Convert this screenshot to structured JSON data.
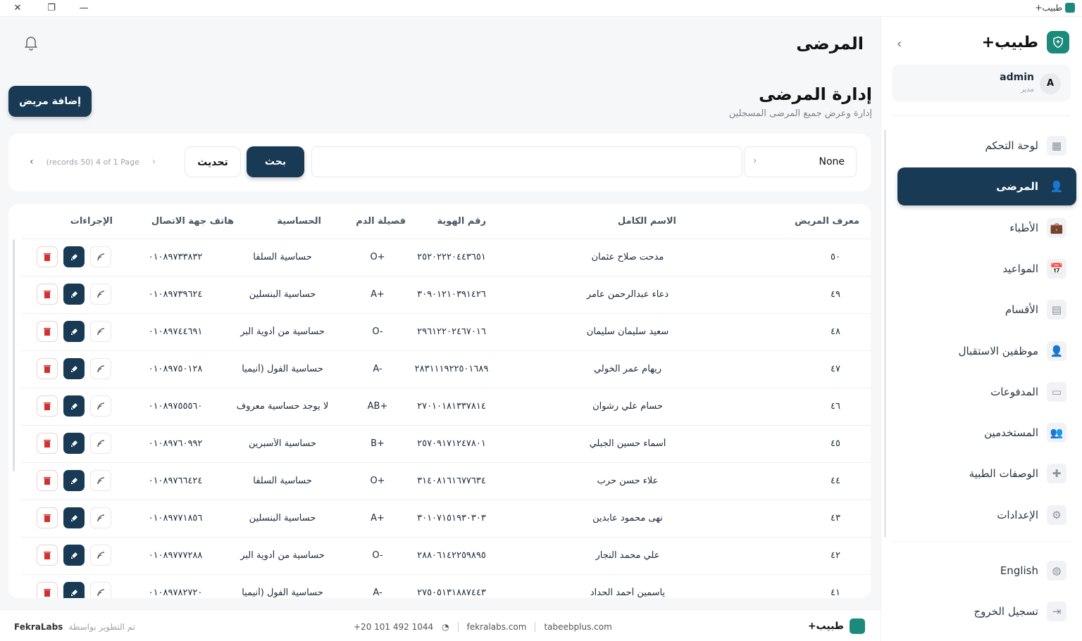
{
  "titlebar": {
    "app_title": "طبيب+",
    "close": "✕",
    "restore": "❐",
    "minimize": "—"
  },
  "sidebar": {
    "brand": "طبيب+",
    "user": {
      "initial": "A",
      "name": "admin",
      "role": "مدير"
    },
    "items": [
      {
        "label": "لوحة التحكم",
        "icon": "dashboard-icon",
        "glyph": "▦"
      },
      {
        "label": "المرضى",
        "icon": "person-icon",
        "glyph": "👤",
        "active": true
      },
      {
        "label": "الأطباء",
        "icon": "briefcase-icon",
        "glyph": "💼"
      },
      {
        "label": "المواعيد",
        "icon": "calendar-icon",
        "glyph": "📅"
      },
      {
        "label": "الأقسام",
        "icon": "building-icon",
        "glyph": "▤"
      },
      {
        "label": "موظفين الاستقبال",
        "icon": "person-icon",
        "glyph": "👤"
      },
      {
        "label": "المدفوعات",
        "icon": "card-icon",
        "glyph": "▭"
      },
      {
        "label": "المستخدمين",
        "icon": "group-icon",
        "glyph": "👥"
      },
      {
        "label": "الوصفات الطبية",
        "icon": "medical-plus-icon",
        "glyph": "✚"
      },
      {
        "label": "الإعدادات",
        "icon": "gear-icon",
        "glyph": "⚙"
      }
    ],
    "language": {
      "label": "English",
      "icon": "globe-icon"
    },
    "logout": {
      "label": "تسجيل الخروج",
      "icon": "logout-icon"
    }
  },
  "header": {
    "title": "المرضى"
  },
  "section": {
    "title": "إدارة المرضى",
    "subtitle": "إدارة وعرض جميع المرضى المسجلين",
    "add_label": "إضافة مريض"
  },
  "filters": {
    "select_value": "None",
    "search_label": "بحث",
    "refresh_label": "تحديث",
    "page_info": "(records 50) 4 of 1 Page"
  },
  "table": {
    "headers": {
      "id": "معرف المريض",
      "name": "الاسم الكامل",
      "national_id": "رقم الهوية",
      "blood": "فصيلة الدم",
      "allergy": "الحساسية",
      "phone": "هاتف جهة الاتصال",
      "actions": "الإجراءات"
    },
    "rows": [
      {
        "id": "٥٠",
        "name": "مدحت صلاح عثمان",
        "national_id": "٢٥٢٠٢٢٢٠٤٤٣٦٥١",
        "blood": "O+",
        "allergy": "حساسية السلفا",
        "phone": "٠١٠٨٩٧٣٣٨٣٢"
      },
      {
        "id": "٤٩",
        "name": "دعاء عبدالرحمن عامر",
        "national_id": "٣٠٩٠١٢١٠٣٩١٤٢٦",
        "blood": "A+",
        "allergy": "حساسية البنسلين",
        "phone": "٠١٠٨٩٧٣٩٦٢٤"
      },
      {
        "id": "٤٨",
        "name": "سعيد سليمان سليمان",
        "national_id": "٢٩٦١٢٢٠٢٤٦٧٠١٦",
        "blood": "O-",
        "allergy": "حساسية من أدوية البر",
        "phone": "٠١٠٨٩٧٤٤٦٩١"
      },
      {
        "id": "٤٧",
        "name": "ريهام عمر الخولي",
        "national_id": "٢٨٣١١١٩٢٢٥٠١٦٨٩",
        "blood": "A-",
        "allergy": "حساسية الفول (أنيميا",
        "phone": "٠١٠٨٩٧٥٠١٢٨"
      },
      {
        "id": "٤٦",
        "name": "حسام علي رشوان",
        "national_id": "٢٧٠١٠١٨١٣٣٧٨١٤",
        "blood": "AB+",
        "allergy": "لا يوجد حساسية معروف",
        "phone": "٠١٠٨٩٧٥٥٥٦٠"
      },
      {
        "id": "٤٥",
        "name": "أسماء حسين الجبلي",
        "national_id": "٢٥٧٠٩١٧١٢٤٧٨٠١",
        "blood": "B+",
        "allergy": "حساسية الأسبرين",
        "phone": "٠١٠٨٩٧٦٠٩٩٢"
      },
      {
        "id": "٤٤",
        "name": "علاء حسن حرب",
        "national_id": "٣١٤٠٨١٦١٦٧٧٦٣٤",
        "blood": "O+",
        "allergy": "حساسية السلفا",
        "phone": "٠١٠٨٩٧٦٦٤٢٤"
      },
      {
        "id": "٤٣",
        "name": "نهى محمود عابدين",
        "national_id": "٣٠١٠٧١٥١٩٣٠٣٠٣",
        "blood": "A+",
        "allergy": "حساسية البنسلين",
        "phone": "٠١٠٨٩٧٧١٨٥٦"
      },
      {
        "id": "٤٢",
        "name": "علي محمد النجار",
        "national_id": "٢٨٨٠٦١٤٢٢٥٩٨٩٥",
        "blood": "O-",
        "allergy": "حساسية من أدوية البر",
        "phone": "٠١٠٨٩٧٧٧٢٨٨"
      },
      {
        "id": "٤١",
        "name": "ياسمين أحمد الحداد",
        "national_id": "٢٧٥٠٥١٣١٨٨٧٤٤٣",
        "blood": "A-",
        "allergy": "حساسية الفول (أنيميا",
        "phone": "٠١٠٨٩٧٨٢٧٢٠"
      }
    ]
  },
  "footer": {
    "brand": "طبيب+",
    "site1": "tabeebplus.com",
    "site2": "fekralabs.com",
    "phone": "+20 101 492 1044",
    "dev_text": "تم التطوير بواسطة",
    "company": "FekraLabs"
  }
}
